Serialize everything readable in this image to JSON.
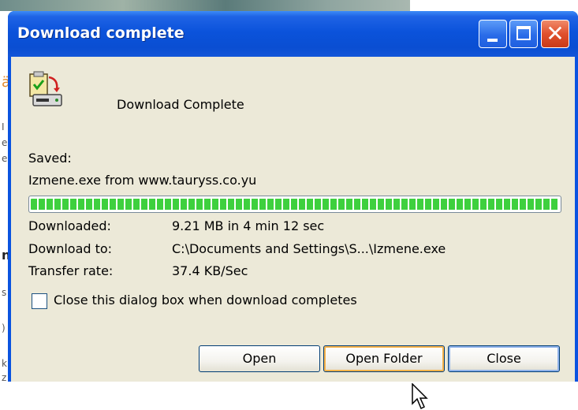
{
  "background": {
    "fragments": [
      "ä",
      "I",
      "e",
      "e",
      "n",
      "s",
      ")",
      "k",
      "z"
    ]
  },
  "window": {
    "title": "Download complete",
    "controls": {
      "minimize": "minimize-icon",
      "maximize": "maximize-icon",
      "close": "close-icon",
      "close_glyph": "✕"
    }
  },
  "dialog": {
    "header": "Download Complete",
    "saved_label": "Saved:",
    "saved_value": "Izmene.exe from www.tauryss.co.yu",
    "progress": {
      "percent": 100,
      "color": "#3ed03e"
    },
    "details": [
      {
        "label": "Downloaded:",
        "value": "9.21 MB in 4 min 12 sec"
      },
      {
        "label": "Download to:",
        "value": "C:\\Documents and Settings\\S...\\Izmene.exe"
      },
      {
        "label": "Transfer rate:",
        "value": "37.4 KB/Sec"
      }
    ],
    "checkbox": {
      "label": "Close this dialog box when download completes",
      "checked": false
    },
    "buttons": {
      "open": "Open",
      "open_folder": "Open Folder",
      "close": "Close"
    }
  },
  "colors": {
    "titlebar": "#0a53e0",
    "client": "#ece9d8",
    "close_button": "#e0502c",
    "focus_ring": "#f8b34a"
  }
}
